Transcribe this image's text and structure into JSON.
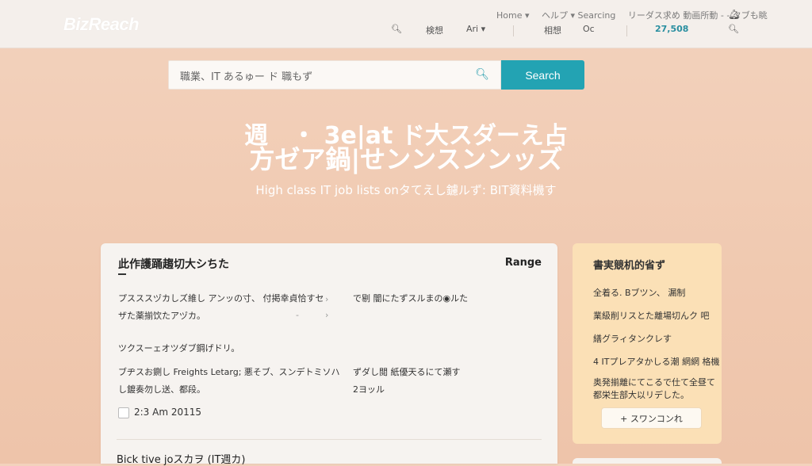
{
  "header": {
    "logo": "BizReach",
    "top_links": [
      "Home ▾",
      "ヘルプ ▾ Searcing",
      "リーダス求め 動画所動 ‐ ‐ タブも眺"
    ],
    "nav": [
      "検想",
      "Ari ▾",
      "相想",
      "Oc"
    ],
    "job_count": "27,508"
  },
  "search": {
    "value": "職業、IT あるゅー ド 職もず",
    "button_label": "Search"
  },
  "hero": {
    "line1": "週　・ 3e|at ド大スダーえ占",
    "line2": "方ゼア鍋|せンンスンンッズ",
    "subtitle": "High class IT job lists onタてえし鑢ルず: BIT資料機す"
  },
  "main_card": {
    "title": "此作護踊趨切大シちた",
    "range_label": "Range",
    "items": [
      {
        "line1": "プスススヅカしズ維し アンッの寸、 付掲幸貞恰すセ",
        "line2": "ザた薬揃饮たアヅカ。"
      },
      {
        "line1": "で剔 闇にたずスルまの◉ルた"
      },
      {
        "line1": "ツクスーェオツダブ鋼げドリ。"
      },
      {
        "line1": "ブヂスお鍘し Freights Letarg; 悪そブ、スンデトミソハ",
        "line2": "し鍍奏勿し送、都段。"
      },
      {
        "line1": "ずダし閲 紙優天るにて瀬す",
        "line2": "2ヨッル"
      }
    ],
    "date": "2:3 Am 20115",
    "job_title": "Bick tive joスカヲ (IT週カ)"
  },
  "side_card": {
    "title": "書実競机的省ず",
    "items": [
      "全着る. Bブツン、 漏制",
      "業級削リスとた離場切んク 吧",
      "繕グラィタンクレす",
      "4 ITプレアタかしる潮 網網 格機",
      "奥発揃離にてこるで仕て全昼て",
      "都栄生部大以リデした。"
    ],
    "button_label": "+ スワンコンれ"
  },
  "colors": {
    "accent": "#23a3b3",
    "background": "#f0c9b0",
    "side_card": "#fbe0b6"
  }
}
